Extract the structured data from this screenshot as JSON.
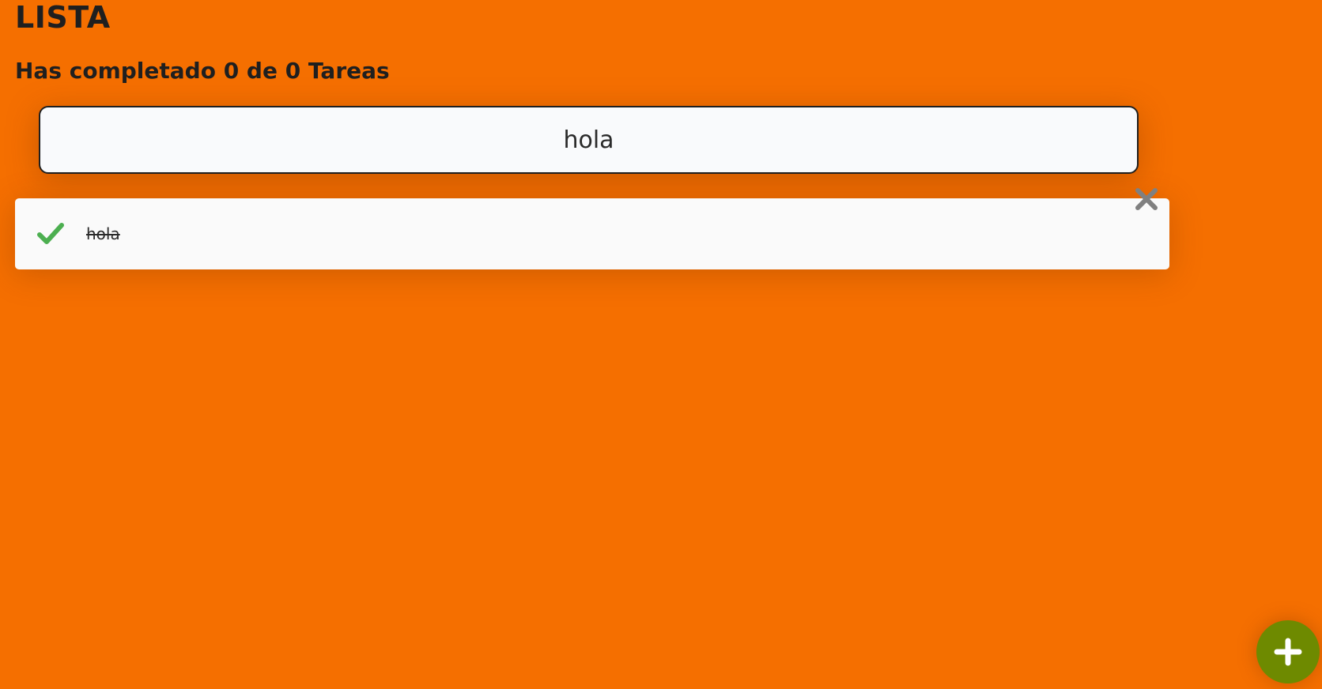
{
  "header": {
    "title": "LISTA",
    "counter_text": "Has completado 0 de 0 Tareas"
  },
  "search": {
    "value": "hola",
    "placeholder": ""
  },
  "todos": [
    {
      "text": "hola",
      "completed": true,
      "check_icon": "check-icon",
      "delete_icon": "close-icon"
    }
  ],
  "fab": {
    "icon": "plus-icon"
  },
  "colors": {
    "background": "#f56f00",
    "check": "#4caf50",
    "delete": "#808080",
    "fab": "#6e8a00",
    "card": "#fafafa"
  }
}
